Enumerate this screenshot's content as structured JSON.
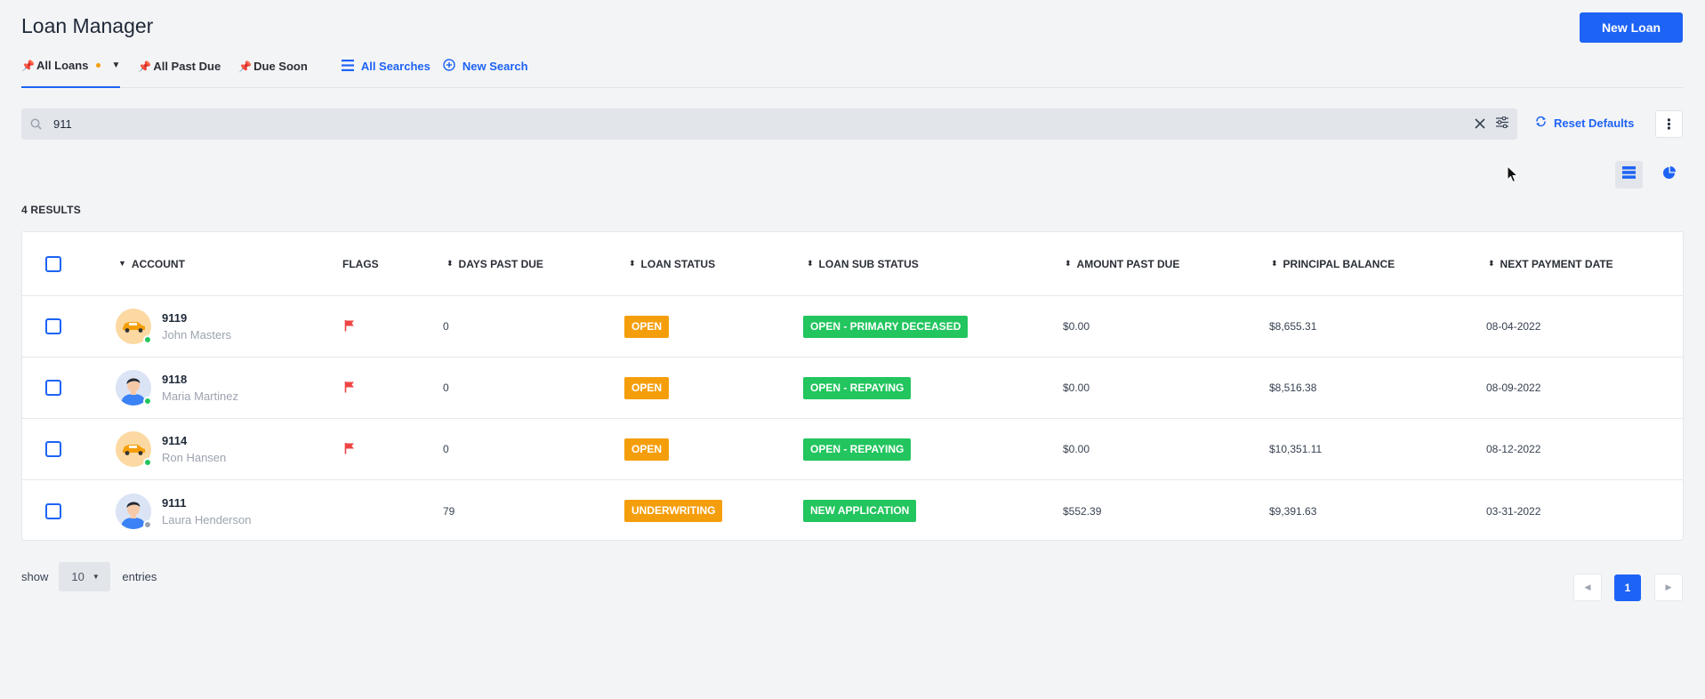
{
  "app": {
    "title": "Loan Manager",
    "new_loan_label": "New Loan",
    "accent": "#1d63f5"
  },
  "tabs": [
    {
      "label": "All Loans",
      "active": true
    },
    {
      "label": "All Past Due",
      "active": false
    },
    {
      "label": "Due Soon",
      "active": false
    }
  ],
  "links": {
    "all_searches": "All Searches",
    "new_search": "New Search"
  },
  "search": {
    "value": "911",
    "placeholder": ""
  },
  "reset_defaults_label": "Reset Defaults",
  "results_label": "4 RESULTS",
  "table": {
    "headers": {
      "account": "ACCOUNT",
      "flags": "FLAGS",
      "days_past_due": "DAYS PAST DUE",
      "loan_status": "LOAN STATUS",
      "loan_sub_status": "LOAN SUB STATUS",
      "amount_past_due": "AMOUNT PAST DUE",
      "principal_balance": "PRINCIPAL BALANCE",
      "next_payment_date": "NEXT PAYMENT DATE"
    },
    "rows": [
      {
        "account": "9119",
        "name": "John Masters",
        "avatar": "car-icon",
        "online": "#22c55e",
        "flag": true,
        "days_past_due": "0",
        "status": "OPEN",
        "status_color": "#f59e0b",
        "sub_status": "OPEN - PRIMARY DECEASED",
        "sub_status_color": "#22c55e",
        "amount_past_due": "$0.00",
        "principal_balance": "$8,655.31",
        "next_payment_date": "08-04-2022"
      },
      {
        "account": "9118",
        "name": "Maria Martinez",
        "avatar": "person-icon",
        "online": "#22c55e",
        "flag": true,
        "days_past_due": "0",
        "status": "OPEN",
        "status_color": "#f59e0b",
        "sub_status": "OPEN - REPAYING",
        "sub_status_color": "#22c55e",
        "amount_past_due": "$0.00",
        "principal_balance": "$8,516.38",
        "next_payment_date": "08-09-2022"
      },
      {
        "account": "9114",
        "name": "Ron Hansen",
        "avatar": "car-icon",
        "online": "#22c55e",
        "flag": true,
        "days_past_due": "0",
        "status": "OPEN",
        "status_color": "#f59e0b",
        "sub_status": "OPEN - REPAYING",
        "sub_status_color": "#22c55e",
        "amount_past_due": "$0.00",
        "principal_balance": "$10,351.11",
        "next_payment_date": "08-12-2022"
      },
      {
        "account": "9111",
        "name": "Laura Henderson",
        "avatar": "person-icon",
        "online": "#9ca3af",
        "flag": false,
        "days_past_due": "79",
        "status": "UNDERWRITING",
        "status_color": "#f59e0b",
        "sub_status": "NEW APPLICATION",
        "sub_status_color": "#22c55e",
        "amount_past_due": "$552.39",
        "principal_balance": "$9,391.63",
        "next_payment_date": "03-31-2022"
      }
    ]
  },
  "pagination": {
    "show_label": "show",
    "page_size": "10",
    "entries_label": "entries",
    "current_page": "1"
  }
}
